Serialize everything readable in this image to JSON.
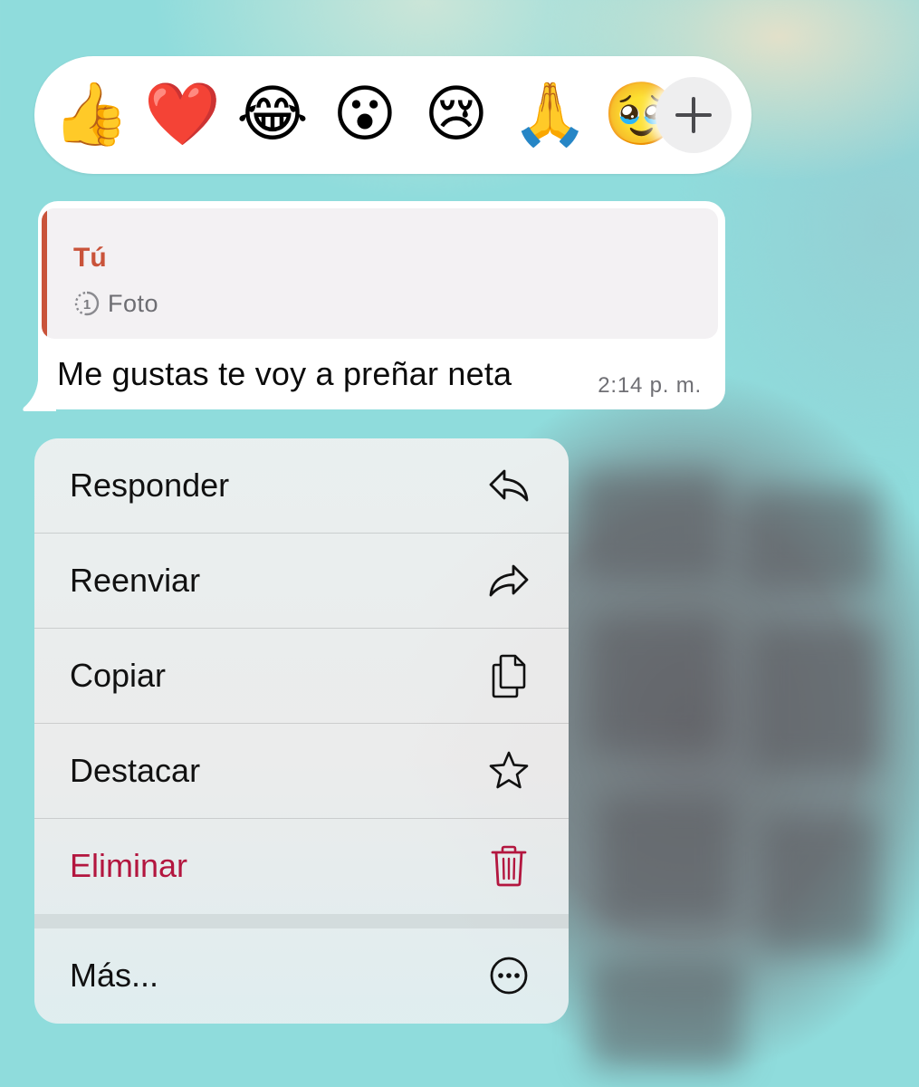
{
  "reactions": {
    "emojis": [
      {
        "name": "thumbs-up",
        "glyph": "👍"
      },
      {
        "name": "red-heart",
        "glyph": "❤️"
      },
      {
        "name": "tears-of-joy",
        "glyph": "😂"
      },
      {
        "name": "surprised",
        "glyph": "😮"
      },
      {
        "name": "crying",
        "glyph": "😢"
      },
      {
        "name": "folded-hands",
        "glyph": "🙏"
      },
      {
        "name": "holding-back-tears",
        "glyph": "🥹"
      }
    ],
    "add_icon": "plus-icon"
  },
  "message": {
    "quote_author": "Tú",
    "quote_type_icon": "view-once-icon",
    "quote_type": "Foto",
    "text": "Me gustas te voy a preñar neta",
    "time": "2:14 p. m.",
    "colors": {
      "quote_accent": "#c9533a"
    }
  },
  "menu": {
    "items": [
      {
        "label": "Responder",
        "icon": "reply-icon"
      },
      {
        "label": "Reenviar",
        "icon": "forward-icon"
      },
      {
        "label": "Copiar",
        "icon": "copy-icon"
      },
      {
        "label": "Destacar",
        "icon": "star-icon"
      },
      {
        "label": "Eliminar",
        "icon": "trash-icon",
        "destructive": true
      },
      {
        "label": "Más...",
        "icon": "more-icon"
      }
    ],
    "colors": {
      "destructive": "#b3163f"
    }
  }
}
